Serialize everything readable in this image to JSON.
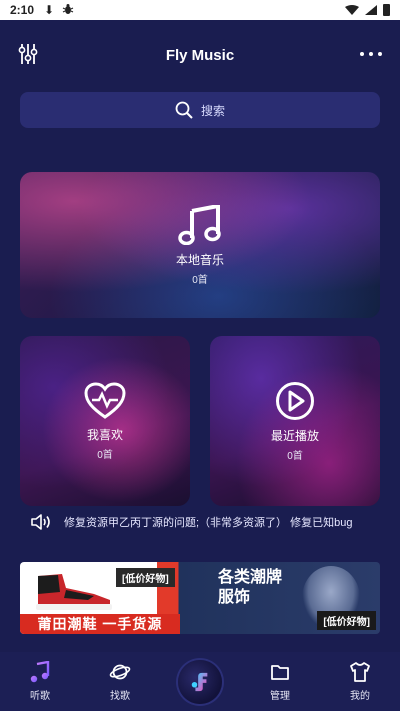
{
  "status_bar": {
    "time": "2:10",
    "icons": [
      "download-icon",
      "bug-icon",
      "wifi-icon",
      "signal-icon",
      "battery-icon"
    ]
  },
  "header": {
    "title": "Fly Music",
    "left_icon": "equalizer-icon",
    "right_icon": "more-icon"
  },
  "search": {
    "placeholder": "搜索",
    "icon": "search-icon"
  },
  "cards": {
    "local": {
      "label": "本地音乐",
      "count": "0首",
      "icon": "music-note-icon"
    },
    "favorite": {
      "label": "我喜欢",
      "count": "0首",
      "icon": "heart-icon"
    },
    "recent": {
      "label": "最近播放",
      "count": "0首",
      "icon": "play-icon"
    }
  },
  "notice": {
    "text": "修复资源甲乙丙丁源的问题;（非常多资源了） 修复已知bug",
    "icon": "speaker-icon"
  },
  "banner": {
    "tag_left": "[低价好物]",
    "bottom_left": "莆田潮鞋 一手货源",
    "headline_1": "各类潮牌",
    "headline_2": "服饰",
    "tag_right": "[低价好物]"
  },
  "nav": {
    "items": [
      {
        "label": "听歌",
        "icon": "music-icon"
      },
      {
        "label": "找歌",
        "icon": "planet-icon"
      },
      {
        "label": "",
        "icon": "fly-logo-icon"
      },
      {
        "label": "管理",
        "icon": "folder-icon"
      },
      {
        "label": "我的",
        "icon": "shirt-icon"
      }
    ]
  },
  "colors": {
    "background": "#1a1d50",
    "search_bg": "#2a2d72",
    "nav_bg": "#1c1f55"
  }
}
